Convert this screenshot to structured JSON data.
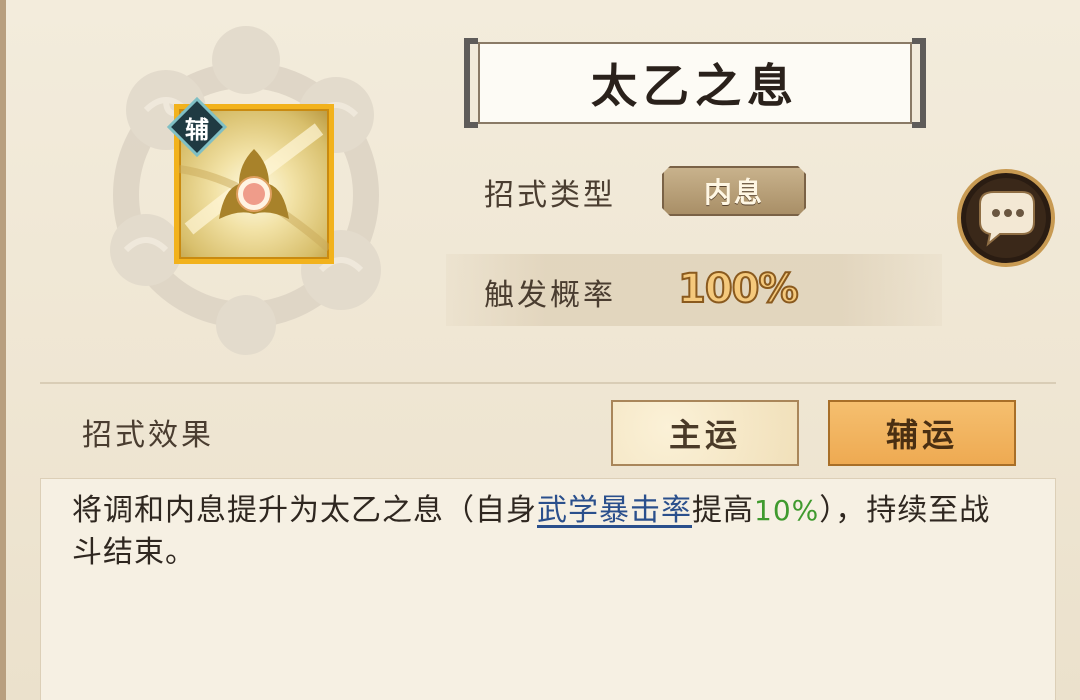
{
  "skill": {
    "name": "太乙之息",
    "badge": "辅",
    "icon": "lotus-orb-icon",
    "type_label": "招式类型",
    "type_value": "内息",
    "rate_label": "触发概率",
    "rate_value": "100%"
  },
  "effect": {
    "label": "招式效果",
    "tabs": [
      {
        "label": "主运",
        "active": false
      },
      {
        "label": "辅运",
        "active": true
      }
    ],
    "description": {
      "part1": "将调和内息提升为太乙之息（自身",
      "keyword": "武学暴击率",
      "part2": "提高",
      "value": "10%",
      "part3": "），持续至战斗结束。"
    }
  },
  "colors": {
    "accent_tab": "#eeaa52",
    "icon_border": "#f2b21c",
    "keyword": "#2a4f8c",
    "value_green": "#3f9a2e"
  },
  "chat_icon": "speech-bubble-icon"
}
